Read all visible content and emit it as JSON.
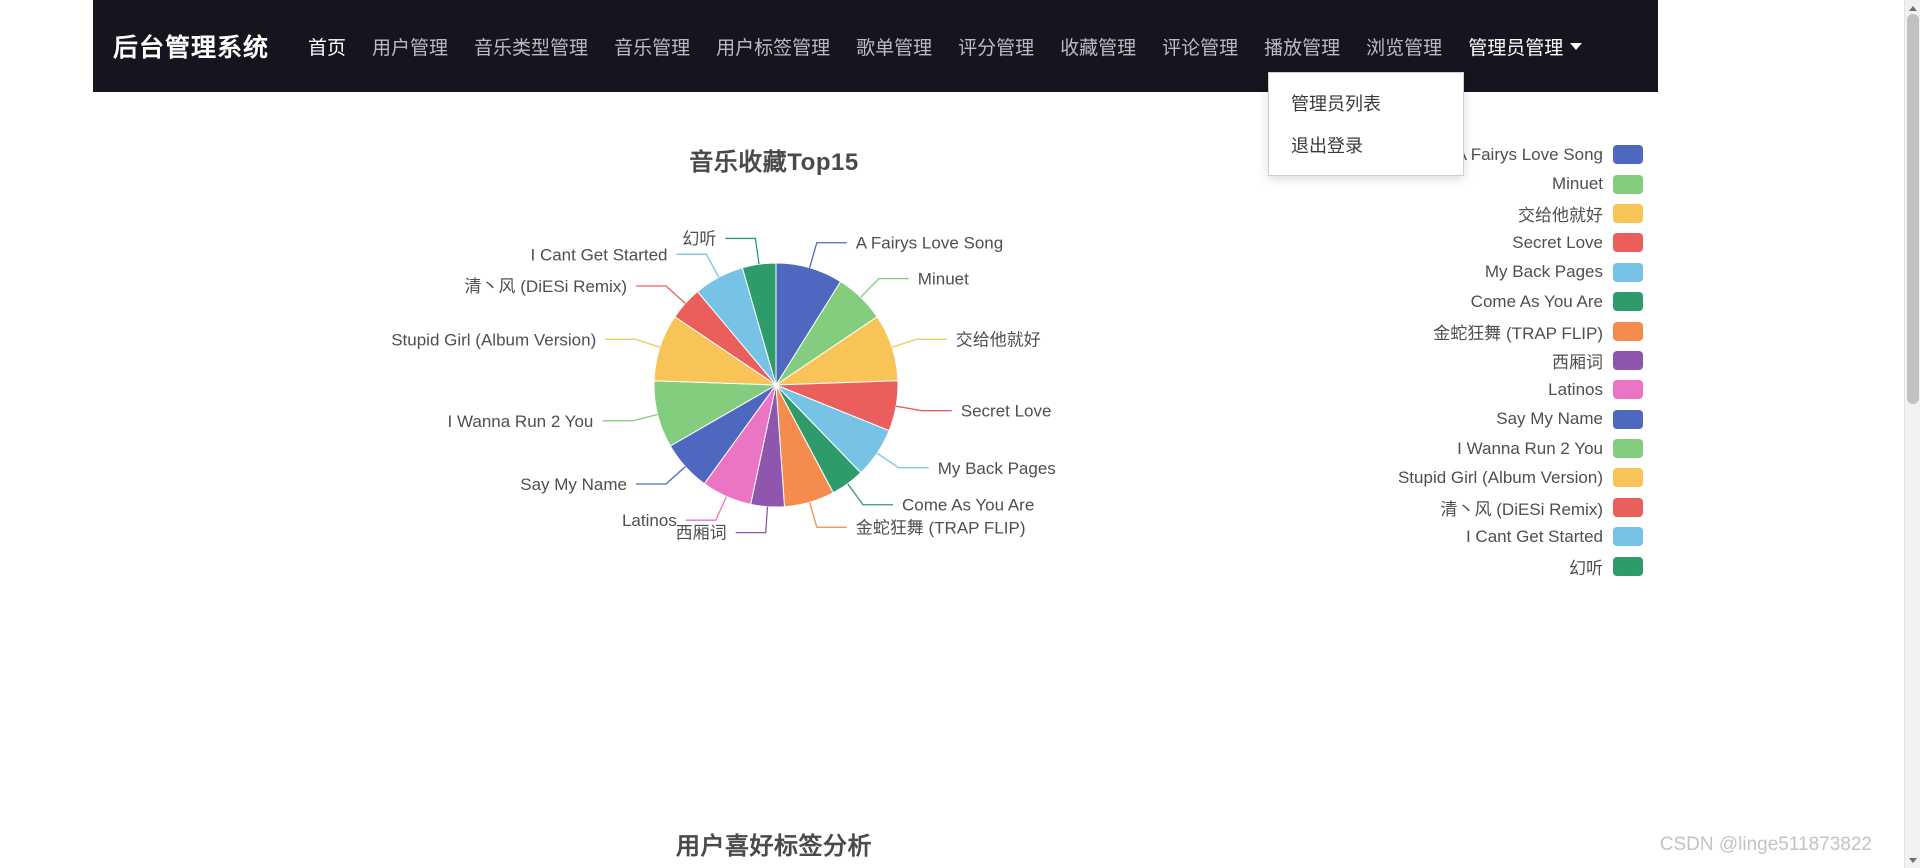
{
  "navbar": {
    "brand": "后台管理系统",
    "links": [
      {
        "label": "首页",
        "active": true
      },
      {
        "label": "用户管理",
        "active": false
      },
      {
        "label": "音乐类型管理",
        "active": false
      },
      {
        "label": "音乐管理",
        "active": false
      },
      {
        "label": "用户标签管理",
        "active": false
      },
      {
        "label": "歌单管理",
        "active": false
      },
      {
        "label": "评分管理",
        "active": false
      },
      {
        "label": "收藏管理",
        "active": false
      },
      {
        "label": "评论管理",
        "active": false
      },
      {
        "label": "播放管理",
        "active": false
      },
      {
        "label": "浏览管理",
        "active": false
      }
    ],
    "dropdown": {
      "label": "管理员管理",
      "caret_icon": "chevron-down-icon",
      "items": [
        {
          "label": "管理员列表"
        },
        {
          "label": "退出登录"
        }
      ]
    }
  },
  "chart_data": {
    "type": "pie",
    "title": "音乐收藏Top15",
    "xlabel": "",
    "ylabel": "",
    "legend_position": "right",
    "grid": false,
    "categories": [
      "A Fairys Love Song",
      "Minuet",
      "交给他就好",
      "Secret Love",
      "My Back Pages",
      "Come As You Are",
      "金蛇狂舞 (TRAP FLIP)",
      "西厢词",
      "Latinos",
      "Say My Name",
      "I Wanna Run 2 You",
      "Stupid Girl (Album Version)",
      "清丶风 (DiESi Remix)",
      "I Cant Get Started",
      "幻听"
    ],
    "values": [
      4,
      3,
      4,
      3,
      3,
      2,
      3,
      2,
      3,
      3,
      4,
      4,
      2,
      3,
      2
    ],
    "colors": [
      "#4e68c0",
      "#84cd7e",
      "#f9c457",
      "#ea5f5c",
      "#76c3e5",
      "#2e9b6b",
      "#f58b4c",
      "#9055ac",
      "#ec74c4",
      "#4e68c0",
      "#84cd7e",
      "#f9c457",
      "#ea5f5c",
      "#76c3e5",
      "#2e9b6b"
    ]
  },
  "chart2": {
    "title": "用户喜好标签分析"
  },
  "watermark": {
    "text": "CSDN @linge511873822"
  },
  "scrollbar": {
    "up_icon": "caret-up-icon",
    "down_icon": "caret-down-icon"
  }
}
